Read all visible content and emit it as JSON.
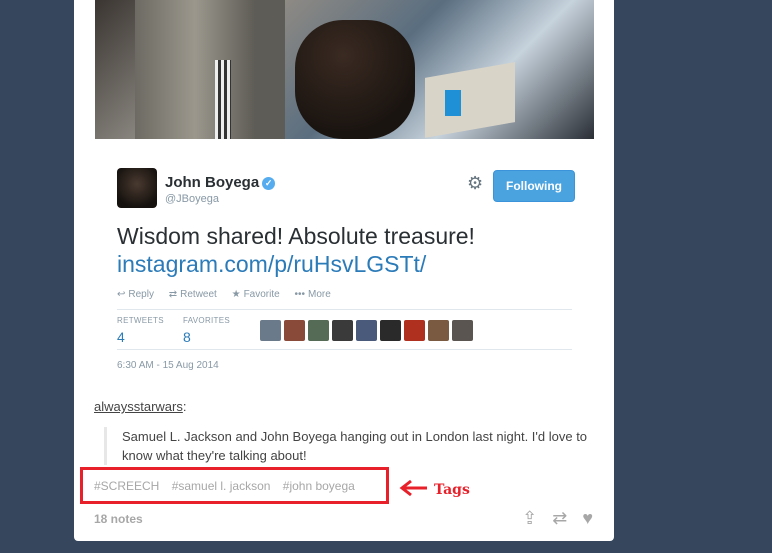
{
  "tweet": {
    "display_name": "John Boyega",
    "handle": "@JBoyega",
    "follow_label": "Following",
    "text": "Wisdom shared! Absolute treasure!",
    "link": "instagram.com/p/ruHsvLGSTt/",
    "actions": {
      "reply": "Reply",
      "retweet": "Retweet",
      "favorite": "Favorite",
      "more": "More"
    },
    "stats": {
      "retweets_label": "RETWEETS",
      "retweets": "4",
      "favorites_label": "FAVORITES",
      "favorites": "8"
    },
    "timestamp": "6:30 AM - 15 Aug 2014"
  },
  "post": {
    "reblog_author": "alwaysstarwars",
    "quote": "Samuel L. Jackson and John Boyega hanging out in London last night.   I'd love to know what they're talking about!",
    "tags": [
      "#SCREECH",
      "#samuel l. jackson",
      "#john boyega"
    ],
    "notes": "18 notes"
  },
  "annotation": {
    "label": "Tags",
    "color": "#e8202a"
  },
  "colors": {
    "background": "#36465d",
    "link": "#2b7bb9",
    "follow_button": "#4aa3df"
  },
  "icons": [
    "gear-icon",
    "verified-icon",
    "reply-icon",
    "retweet-icon",
    "favorite-icon",
    "more-icon",
    "share-icon",
    "reblog-icon",
    "like-icon"
  ]
}
